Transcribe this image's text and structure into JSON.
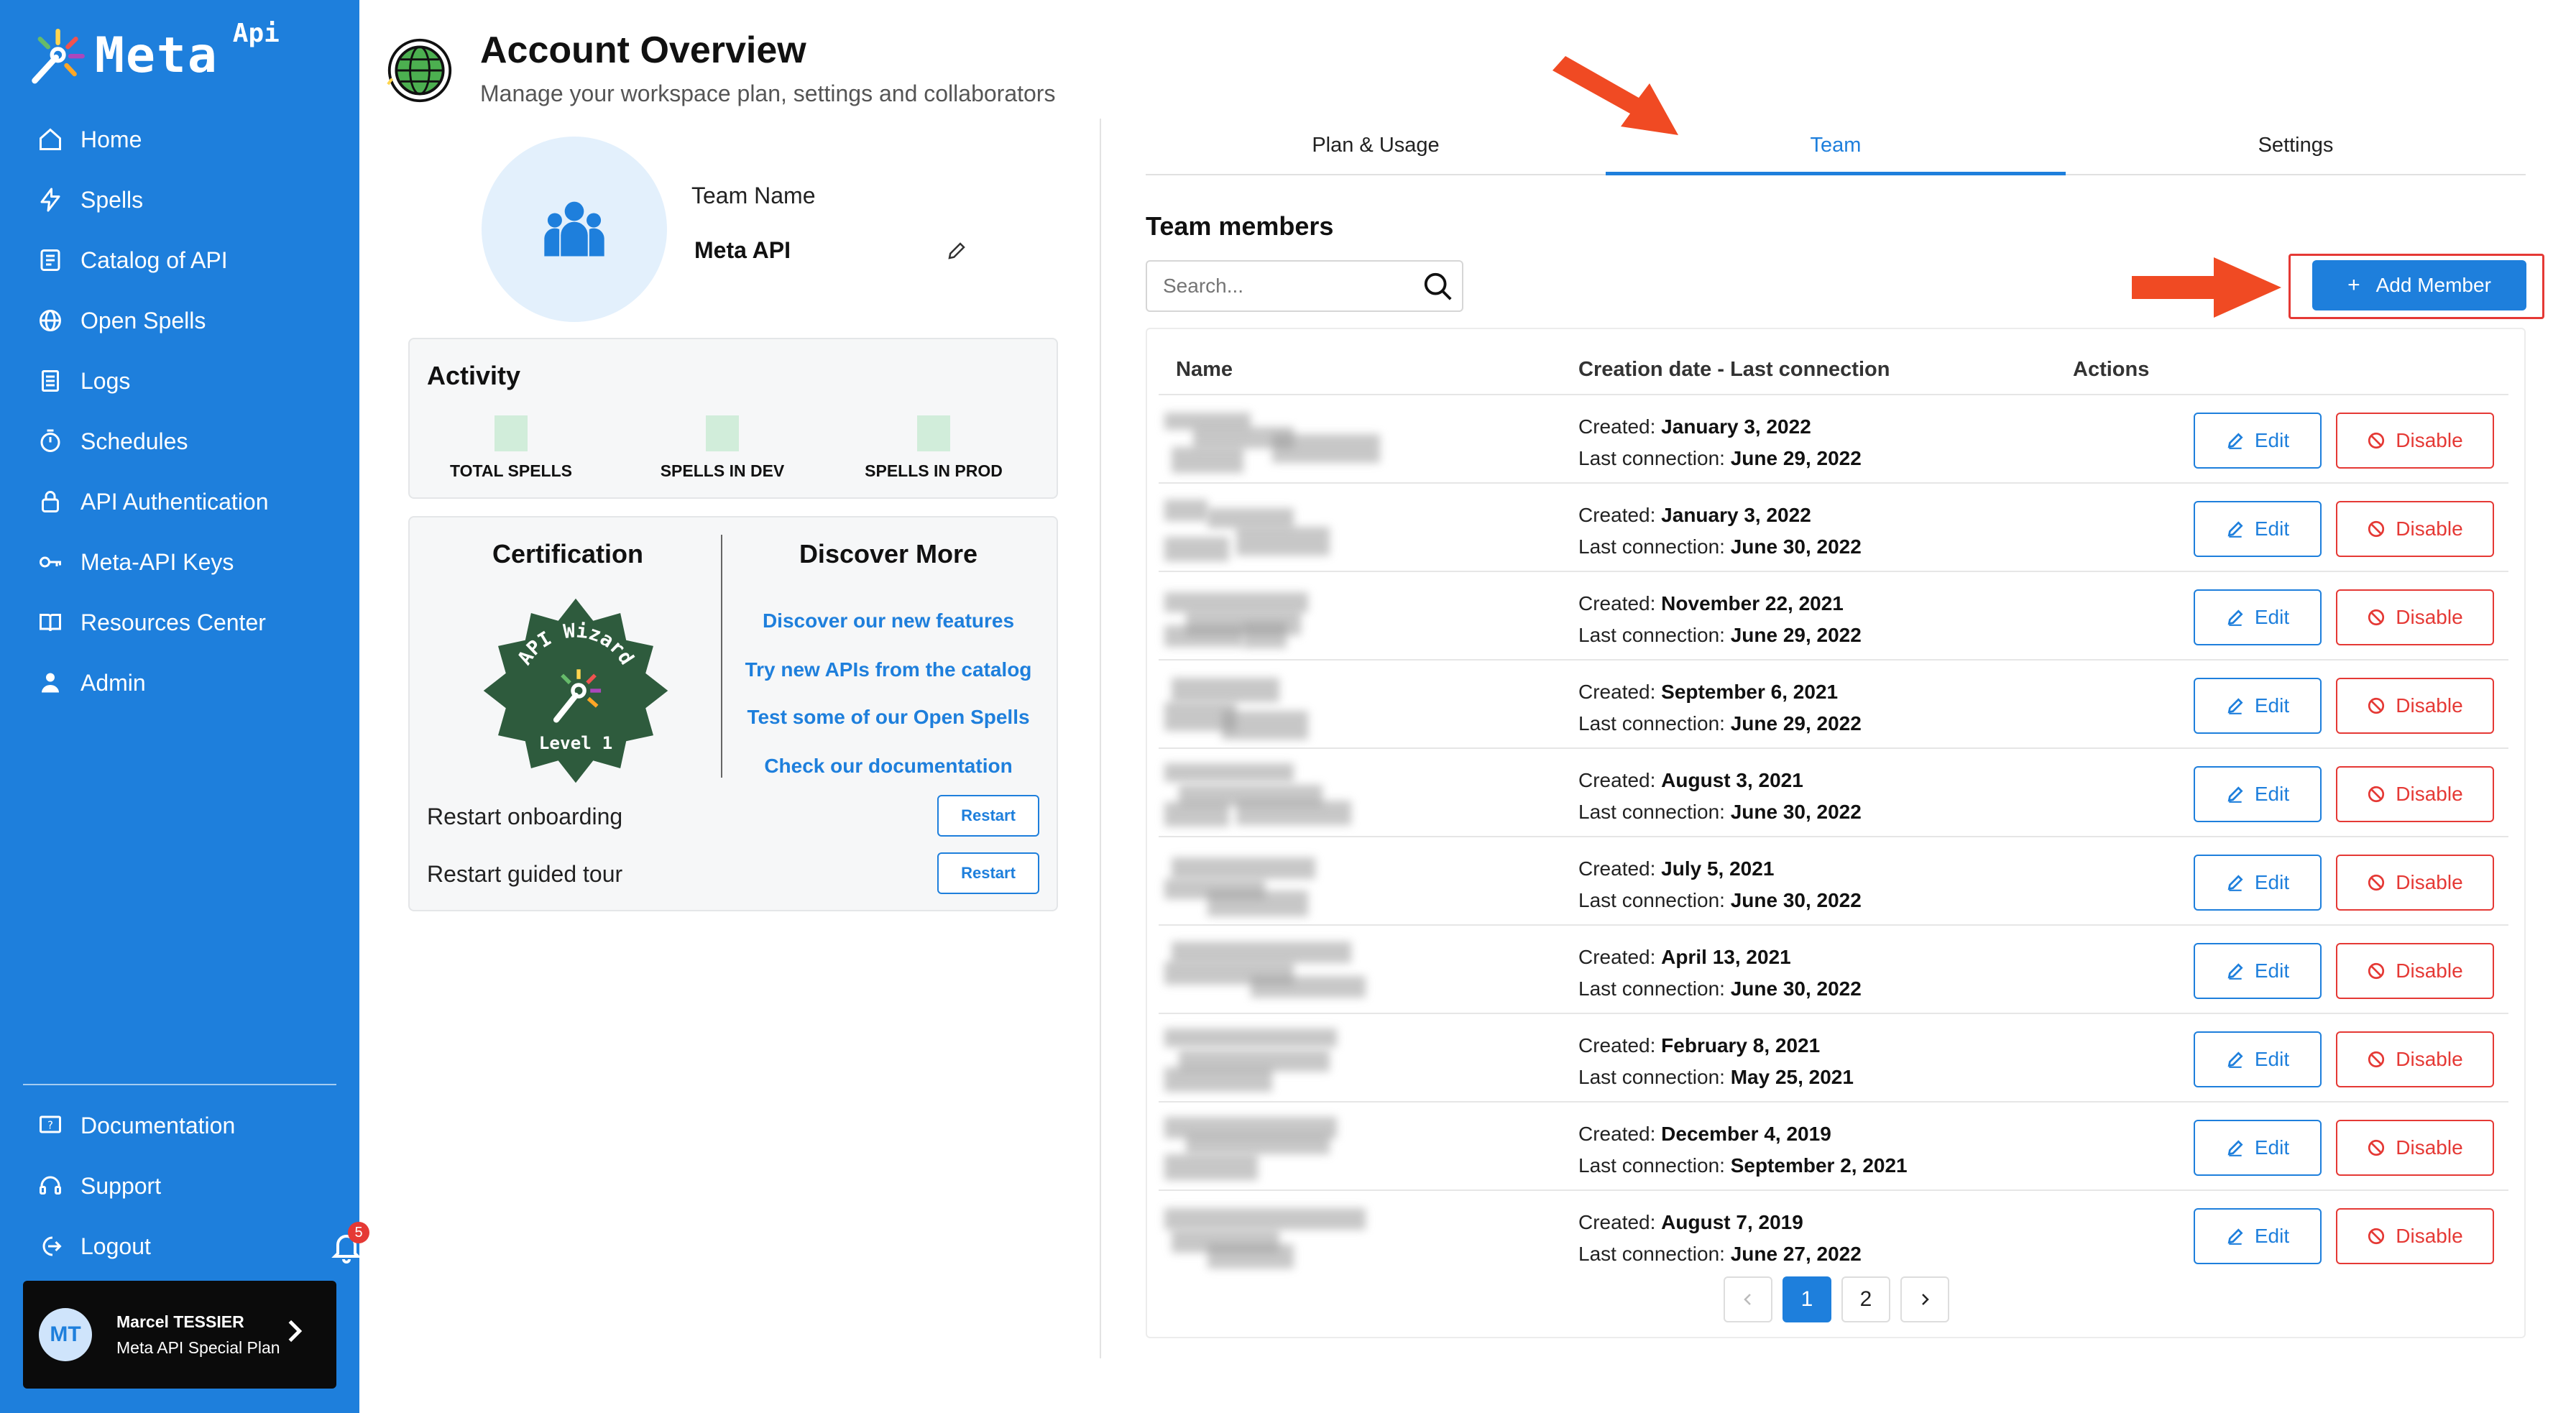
{
  "brand": {
    "name": "Meta",
    "sup": "Api",
    "accent": "#1e7fdc",
    "danger": "#e53935"
  },
  "sidebar": {
    "items": [
      {
        "label": "Home",
        "icon": "home-icon"
      },
      {
        "label": "Spells",
        "icon": "lightning-icon"
      },
      {
        "label": "Catalog of API",
        "icon": "catalog-icon"
      },
      {
        "label": "Open Spells",
        "icon": "globe-icon"
      },
      {
        "label": "Logs",
        "icon": "logs-icon"
      },
      {
        "label": "Schedules",
        "icon": "timer-icon"
      },
      {
        "label": "API Authentication",
        "icon": "lock-icon"
      },
      {
        "label": "Meta-API Keys",
        "icon": "key-icon"
      },
      {
        "label": "Resources Center",
        "icon": "book-icon"
      },
      {
        "label": "Admin",
        "icon": "admin-icon"
      }
    ],
    "bottom": [
      {
        "label": "Documentation",
        "icon": "documentation-icon"
      },
      {
        "label": "Support",
        "icon": "headset-icon"
      },
      {
        "label": "Logout",
        "icon": "logout-icon"
      }
    ],
    "notifications": "5"
  },
  "user": {
    "initials": "MT",
    "name": "Marcel TESSIER",
    "plan": "Meta API Special Plan"
  },
  "header": {
    "title": "Account Overview",
    "subtitle": "Manage your workspace plan, settings and collaborators"
  },
  "team": {
    "label": "Team Name",
    "value": "Meta API"
  },
  "activity": {
    "title": "Activity",
    "stats": [
      "TOTAL SPELLS",
      "SPELLS IN DEV",
      "SPELLS IN PROD"
    ]
  },
  "certification": {
    "title": "Certification",
    "badge_top": "API Wizard",
    "badge_level": "Level 1"
  },
  "discover": {
    "title": "Discover More",
    "links": [
      "Discover our new features",
      "Try new APIs from the catalog",
      "Test some of our Open Spells",
      "Check our documentation"
    ]
  },
  "restart": {
    "onboarding": "Restart onboarding",
    "tour": "Restart guided tour",
    "button": "Restart"
  },
  "tabs": [
    "Plan & Usage",
    "Team",
    "Settings"
  ],
  "members": {
    "title": "Team members",
    "search_placeholder": "Search...",
    "add_label": "Add Member",
    "columns": [
      "Name",
      "Creation date - Last connection",
      "Actions"
    ],
    "created_prefix": "Created:",
    "last_prefix": "Last connection:",
    "edit_label": "Edit",
    "disable_label": "Disable",
    "rows": [
      {
        "created": "January 3, 2022",
        "last": "June 29, 2022"
      },
      {
        "created": "January 3, 2022",
        "last": "June 30, 2022"
      },
      {
        "created": "November 22, 2021",
        "last": "June 29, 2022"
      },
      {
        "created": "September 6, 2021",
        "last": "June 29, 2022"
      },
      {
        "created": "August 3, 2021",
        "last": "June 30, 2022"
      },
      {
        "created": "July 5, 2021",
        "last": "June 30, 2022"
      },
      {
        "created": "April 13, 2021",
        "last": "June 30, 2022"
      },
      {
        "created": "February 8, 2021",
        "last": "May 25, 2021"
      },
      {
        "created": "December 4, 2019",
        "last": "September 2, 2021"
      },
      {
        "created": "August 7, 2019",
        "last": "June 27, 2022"
      }
    ]
  },
  "pagination": {
    "pages": [
      "1",
      "2"
    ],
    "current": "1"
  }
}
